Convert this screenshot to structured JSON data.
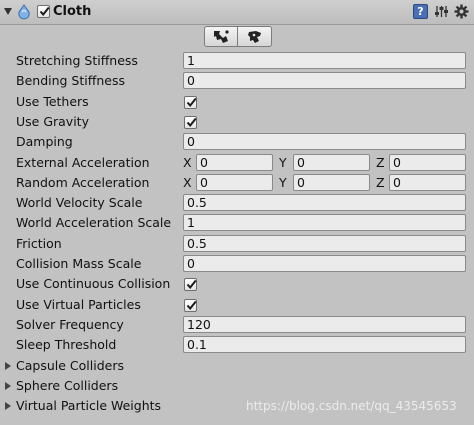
{
  "component": {
    "title": "Cloth",
    "enabled": true
  },
  "toolbar": {
    "buttons": [
      {
        "icon": "cloth-edit-constraints-icon"
      },
      {
        "icon": "cloth-self-collision-icon"
      }
    ]
  },
  "properties": [
    {
      "label": "Stretching Stiffness",
      "type": "float",
      "value": "1"
    },
    {
      "label": "Bending Stiffness",
      "type": "float",
      "value": "0"
    },
    {
      "label": "Use Tethers",
      "type": "bool",
      "checked": true
    },
    {
      "label": "Use Gravity",
      "type": "bool",
      "checked": true
    },
    {
      "label": "Damping",
      "type": "float",
      "value": "0"
    },
    {
      "label": "External Acceleration",
      "type": "vector3",
      "x_label": "X",
      "y_label": "Y",
      "z_label": "Z",
      "x": "0",
      "y": "0",
      "z": "0"
    },
    {
      "label": "Random Acceleration",
      "type": "vector3",
      "x_label": "X",
      "y_label": "Y",
      "z_label": "Z",
      "x": "0",
      "y": "0",
      "z": "0"
    },
    {
      "label": "World Velocity Scale",
      "type": "float",
      "value": "0.5"
    },
    {
      "label": "World Acceleration Scale",
      "type": "float",
      "value": "1"
    },
    {
      "label": "Friction",
      "type": "float",
      "value": "0.5"
    },
    {
      "label": "Collision Mass Scale",
      "type": "float",
      "value": "0"
    },
    {
      "label": "Use Continuous Collision",
      "type": "bool",
      "checked": true
    },
    {
      "label": "Use Virtual Particles",
      "type": "bool",
      "checked": true
    },
    {
      "label": "Solver Frequency",
      "type": "float",
      "value": "120"
    },
    {
      "label": "Sleep Threshold",
      "type": "float",
      "value": "0.1"
    }
  ],
  "foldouts": [
    {
      "label": "Capsule Colliders"
    },
    {
      "label": "Sphere Colliders"
    },
    {
      "label": "Virtual Particle Weights"
    }
  ],
  "watermark": "https://blog.csdn.net/qq_43545653"
}
